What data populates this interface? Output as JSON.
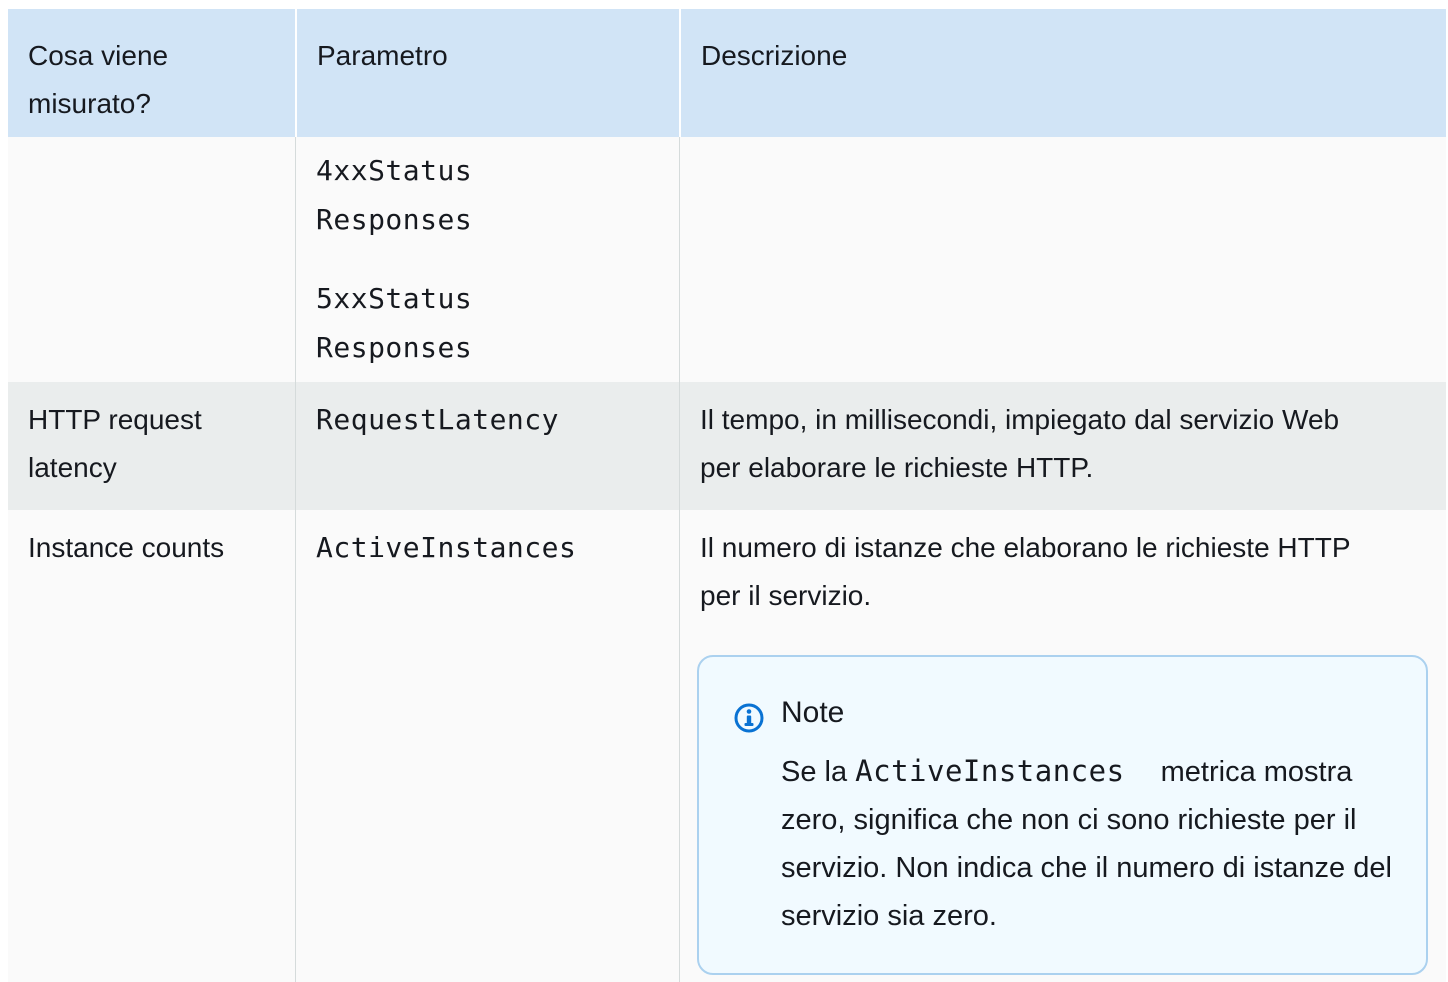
{
  "table": {
    "headers": {
      "what": "Cosa viene misurato?",
      "parameter": "Parametro",
      "description": "Descrizione"
    },
    "rows": [
      {
        "what": "",
        "parameters": [
          "4xxStatus Responses",
          "5xxStatus Responses"
        ],
        "description": ""
      },
      {
        "what": "HTTP request latency",
        "parameters": [
          "RequestLatency"
        ],
        "description": "Il tempo, in millisecondi, impiegato dal servizio Web per elaborare le richieste HTTP."
      },
      {
        "what": "Instance counts",
        "parameters": [
          "ActiveInstances"
        ],
        "description": "Il numero di istanze che elaborano le richieste HTTP per il servizio."
      }
    ]
  },
  "note": {
    "icon": "info-icon",
    "title": "Note",
    "body_prefix": "Se la",
    "body_code": "ActiveInstances",
    "body_suffix": "metrica mostra zero, significa che non ci sono richieste per il servizio. Non indica che il numero di istanze del servizio sia zero."
  },
  "colors": {
    "header_bg": "#d1e4f6",
    "row_light": "#fafafa",
    "row_gray": "#eaeded",
    "note_border": "#abd1ef",
    "note_bg": "#f1faff",
    "info_icon": "#0972d3"
  }
}
